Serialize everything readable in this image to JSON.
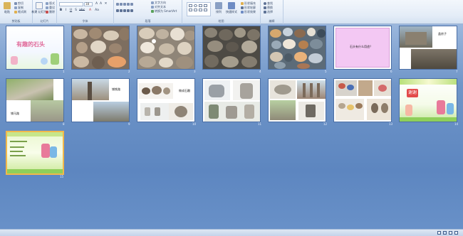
{
  "ribbon": {
    "groups": [
      {
        "label": "剪贴板",
        "paste": "粘贴",
        "items": [
          "剪切",
          "复制",
          "格式刷"
        ]
      },
      {
        "label": "幻灯片",
        "new_slide": "新建\n幻灯片",
        "items": [
          "版式",
          "重设",
          "删除"
        ]
      },
      {
        "label": "字体",
        "font_name": "",
        "font_size": "18",
        "format_buttons": [
          "B",
          "I",
          "U",
          "S",
          "abc",
          "A",
          "Aa"
        ]
      },
      {
        "label": "段落",
        "items": [
          "文字方向",
          "对齐文本",
          "转换为 SmartArt"
        ]
      },
      {
        "label": "绘图",
        "arrange": "排列",
        "quick_styles": "快速样式",
        "items": [
          "形状填充",
          "形状轮廓",
          "形状效果"
        ]
      },
      {
        "label": "编辑",
        "items": [
          "查找",
          "替换",
          "选择"
        ]
      }
    ]
  },
  "slides": [
    {
      "num": "1",
      "caption": "有趣的石头"
    },
    {
      "num": "2",
      "caption": ""
    },
    {
      "num": "3",
      "caption": ""
    },
    {
      "num": "4",
      "caption": ""
    },
    {
      "num": "5",
      "caption": ""
    },
    {
      "num": "6",
      "caption": "石头有什么用途？"
    },
    {
      "num": "7",
      "caption": "盖房子"
    },
    {
      "num": "8",
      "caption": "铺马路"
    },
    {
      "num": "9",
      "caption": "铺铁路"
    },
    {
      "num": "10",
      "caption": "做成石雕"
    },
    {
      "num": "11",
      "caption": ""
    },
    {
      "num": "12",
      "caption": ""
    },
    {
      "num": "13",
      "caption": ""
    },
    {
      "num": "14",
      "caption": "谢谢"
    },
    {
      "num": "15",
      "caption": ""
    }
  ],
  "statusbar": {
    "zoom": "",
    "view_icons": [
      "normal-view-icon",
      "sorter-view-icon",
      "reading-view-icon",
      "slideshow-view-icon"
    ]
  },
  "colors": {
    "ribbon_bg": "#e3ecf7",
    "workspace": "#6f95c8",
    "selected": "#f2b84b"
  }
}
